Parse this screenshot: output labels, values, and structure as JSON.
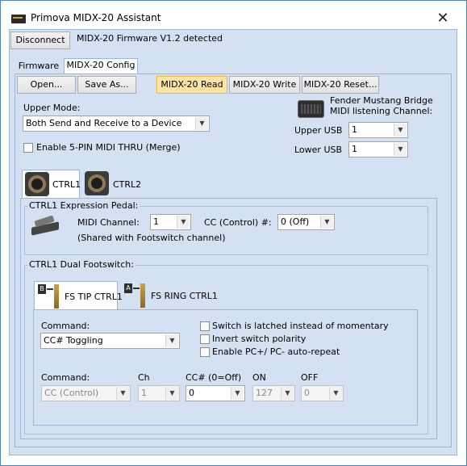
{
  "window": {
    "title": "Primova MIDX-20 Assistant",
    "close_glyph": "✕"
  },
  "top": {
    "disconnect_label": "Disconnect",
    "firmware_status": "MIDX-20 Firmware V1.2 detected"
  },
  "tabs": [
    {
      "label": "Firmware"
    },
    {
      "label": "MIDX-20 Config"
    }
  ],
  "toolbar": {
    "open": "Open...",
    "save_as": "Save As...",
    "read": "MIDX-20 Read",
    "write": "MIDX-20 Write",
    "reset": "MIDX-20 Reset..."
  },
  "upper_mode": {
    "label": "Upper Mode:",
    "value": "Both Send and Receive to a Device"
  },
  "midi_thru": {
    "label": "Enable 5-PIN MIDI THRU (Merge)",
    "checked": false
  },
  "fender": {
    "line1": "Fender Mustang Bridge",
    "line2": "MIDI listening Channel:",
    "upper_usb_label": "Upper USB",
    "upper_usb_value": "1",
    "lower_usb_label": "Lower USB",
    "lower_usb_value": "1"
  },
  "ctrl_tabs": [
    {
      "label": "CTRL1"
    },
    {
      "label": "CTRL2"
    }
  ],
  "expression": {
    "legend": "CTRL1 Expression Pedal:",
    "midi_channel_label": "MIDI Channel:",
    "midi_channel_value": "1",
    "cc_label": "CC (Control) #:",
    "cc_value": "0 (Off)",
    "shared_note": "(Shared with Footswitch channel)"
  },
  "footswitch": {
    "legend": "CTRL1 Dual Footswitch:",
    "tabs": [
      {
        "label": "FS TIP CTRL1",
        "badge": "B"
      },
      {
        "label": "FS RING CTRL1",
        "badge": "A"
      }
    ],
    "command_label": "Command:",
    "command_value": "CC# Toggling",
    "options": [
      {
        "label": "Switch is latched instead of momentary",
        "checked": false
      },
      {
        "label": "Invert switch polarity",
        "checked": false
      },
      {
        "label": "Enable PC+/ PC- auto-repeat",
        "checked": false
      }
    ],
    "row_labels": {
      "command": "Command:",
      "ch": "Ch",
      "cc": "CC# (0=Off)",
      "on": "ON",
      "off": "OFF"
    },
    "row_values": {
      "command": "CC (Control)",
      "ch": "1",
      "cc": "0",
      "on": "127",
      "off": "0"
    }
  },
  "colors": {
    "accent_button": "#fbe3a6",
    "client_bg": "#d4e1f3"
  }
}
